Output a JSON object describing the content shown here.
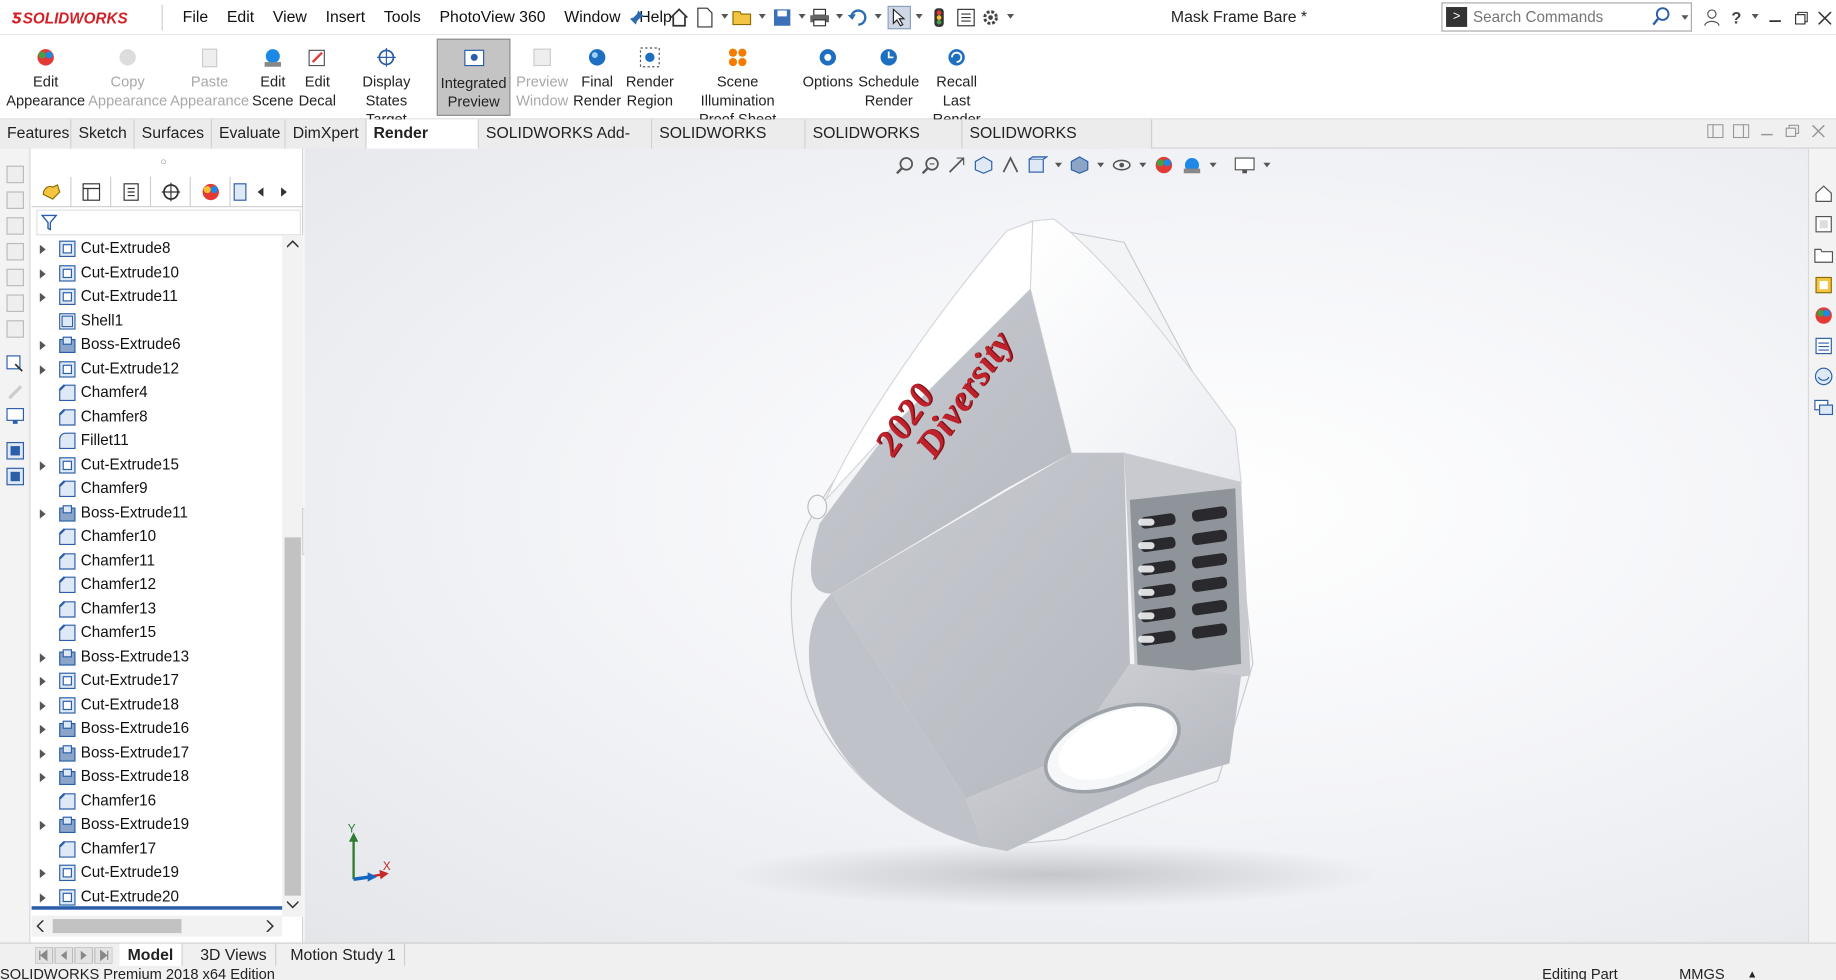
{
  "app": {
    "logo_text": "SOLIDWORKS",
    "document_title": "Mask Frame Bare *"
  },
  "menu": [
    "File",
    "Edit",
    "View",
    "Insert",
    "Tools",
    "PhotoView 360",
    "Window",
    "Help"
  ],
  "search": {
    "placeholder": "Search Commands"
  },
  "command_manager": {
    "buttons": [
      {
        "line1": "Edit",
        "line2": "Appearance",
        "enabled": true
      },
      {
        "line1": "Copy",
        "line2": "Appearance",
        "enabled": false
      },
      {
        "line1": "Paste",
        "line2": "Appearance",
        "enabled": false
      },
      {
        "line1": "Edit",
        "line2": "Scene",
        "enabled": true
      },
      {
        "line1": "Edit",
        "line2": "Decal",
        "enabled": true
      },
      {
        "line1": "Display States",
        "line2": "Target",
        "enabled": true
      },
      {
        "line1": "Integrated",
        "line2": "Preview",
        "enabled": true,
        "active": true
      },
      {
        "line1": "Preview",
        "line2": "Window",
        "enabled": false
      },
      {
        "line1": "Final",
        "line2": "Render",
        "enabled": true
      },
      {
        "line1": "Render",
        "line2": "Region",
        "enabled": true
      },
      {
        "line1": "Scene Illumination",
        "line2": "Proof Sheet",
        "enabled": true
      },
      {
        "line1": "Options",
        "line2": "",
        "enabled": true
      },
      {
        "line1": "Schedule",
        "line2": "Render",
        "enabled": true
      },
      {
        "line1": "Recall Last",
        "line2": "Render",
        "enabled": true
      }
    ]
  },
  "tabs": [
    "Features",
    "Sketch",
    "Surfaces",
    "Evaluate",
    "DimXpert",
    "Render Tools",
    "SOLIDWORKS Add-Ins",
    "SOLIDWORKS MBD",
    "SOLIDWORKS CAM",
    "SOLIDWORKS Inspection"
  ],
  "active_tab": "Render Tools",
  "feature_tree": [
    {
      "label": "Cut-Extrude8",
      "expandable": true,
      "kind": "cut"
    },
    {
      "label": "Cut-Extrude10",
      "expandable": true,
      "kind": "cut"
    },
    {
      "label": "Cut-Extrude11",
      "expandable": true,
      "kind": "cut"
    },
    {
      "label": "Shell1",
      "expandable": false,
      "kind": "shell"
    },
    {
      "label": "Boss-Extrude6",
      "expandable": true,
      "kind": "boss"
    },
    {
      "label": "Cut-Extrude12",
      "expandable": true,
      "kind": "cut"
    },
    {
      "label": "Chamfer4",
      "expandable": false,
      "kind": "chamfer"
    },
    {
      "label": "Chamfer8",
      "expandable": false,
      "kind": "chamfer"
    },
    {
      "label": "Fillet11",
      "expandable": false,
      "kind": "fillet"
    },
    {
      "label": "Cut-Extrude15",
      "expandable": true,
      "kind": "cut"
    },
    {
      "label": "Chamfer9",
      "expandable": false,
      "kind": "chamfer"
    },
    {
      "label": "Boss-Extrude11",
      "expandable": true,
      "kind": "boss"
    },
    {
      "label": "Chamfer10",
      "expandable": false,
      "kind": "chamfer"
    },
    {
      "label": "Chamfer11",
      "expandable": false,
      "kind": "chamfer"
    },
    {
      "label": "Chamfer12",
      "expandable": false,
      "kind": "chamfer"
    },
    {
      "label": "Chamfer13",
      "expandable": false,
      "kind": "chamfer"
    },
    {
      "label": "Chamfer15",
      "expandable": false,
      "kind": "chamfer"
    },
    {
      "label": "Boss-Extrude13",
      "expandable": true,
      "kind": "boss"
    },
    {
      "label": "Cut-Extrude17",
      "expandable": true,
      "kind": "cut"
    },
    {
      "label": "Cut-Extrude18",
      "expandable": true,
      "kind": "cut"
    },
    {
      "label": "Boss-Extrude16",
      "expandable": true,
      "kind": "boss"
    },
    {
      "label": "Boss-Extrude17",
      "expandable": true,
      "kind": "boss"
    },
    {
      "label": "Boss-Extrude18",
      "expandable": true,
      "kind": "boss"
    },
    {
      "label": "Chamfer16",
      "expandable": false,
      "kind": "chamfer"
    },
    {
      "label": "Boss-Extrude19",
      "expandable": true,
      "kind": "boss"
    },
    {
      "label": "Chamfer17",
      "expandable": false,
      "kind": "chamfer"
    },
    {
      "label": "Cut-Extrude19",
      "expandable": true,
      "kind": "cut"
    },
    {
      "label": "Cut-Extrude20",
      "expandable": true,
      "kind": "cut"
    }
  ],
  "model": {
    "engraving_line1": "2020",
    "engraving_line2": "Diversity",
    "engraving_color": "#c0222b"
  },
  "triad": {
    "x": "X",
    "y": "Y"
  },
  "bottom_tabs": [
    "Model",
    "3D Views",
    "Motion Study 1"
  ],
  "active_bottom_tab": "Model",
  "status": {
    "edition": "SOLIDWORKS Premium 2018 x64 Edition",
    "mode": "Editing Part",
    "units": "MMGS"
  },
  "colors": {
    "brand": "#d32027",
    "tree_selection_bar": "#2b5ea8"
  }
}
